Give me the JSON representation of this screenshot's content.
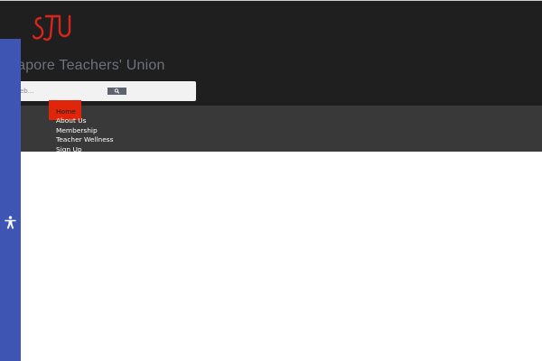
{
  "site": {
    "title": "gapore Teachers' Union",
    "logo_text": "STU",
    "logo_color": "#d9261c"
  },
  "search": {
    "placeholder": "eb...",
    "button_icon": "search-icon"
  },
  "nav": {
    "items": [
      {
        "label": "Home",
        "active": true
      },
      {
        "label": "About Us"
      },
      {
        "label": "Membership"
      },
      {
        "label": "Teacher Wellness"
      },
      {
        "label": "Sign Up"
      }
    ],
    "active_color": "#e0260a"
  },
  "accessibility": {
    "icon": "accessibility-icon",
    "strip_color": "#3f55b4"
  },
  "colors": {
    "header_bg": "#1f1f1f",
    "nav_bg": "#393939",
    "title_color": "#6e727d"
  }
}
